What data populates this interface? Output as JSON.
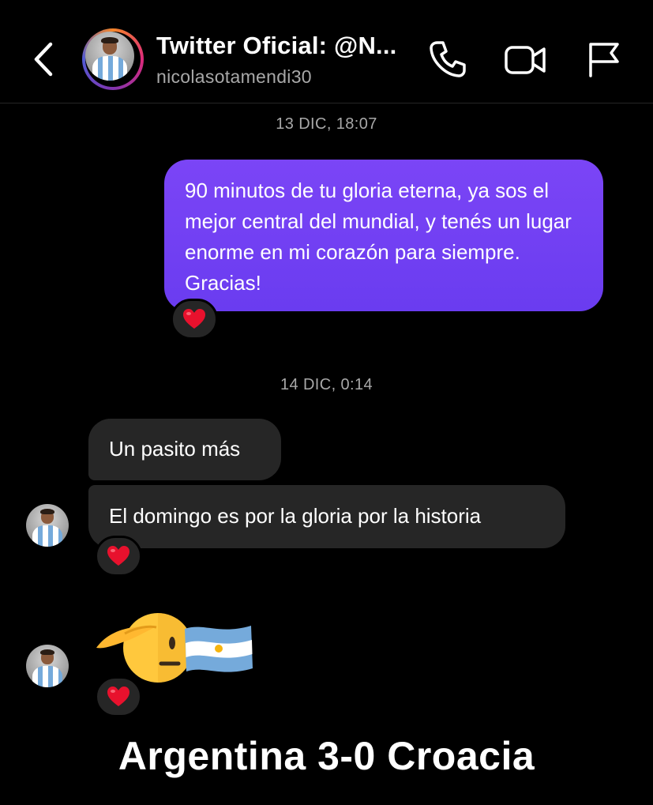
{
  "header": {
    "contact_name": "Twitter Oficial: @N...",
    "username": "nicolasotamendi30",
    "icons": [
      "back-chevron-icon",
      "phone-icon",
      "video-icon",
      "flag-icon"
    ]
  },
  "conversation": {
    "timestamp_1": "13 DIC, 18:07",
    "outgoing_message": "90 minutos de tu gloria eterna, ya sos el mejor central del mundial, y tenés un lugar enorme en mi corazón para siempre. Gracias!",
    "outgoing_reaction": "heart",
    "timestamp_2": "14 DIC, 0:14",
    "incoming_messages": [
      {
        "text": "Un pasito más"
      },
      {
        "text": "El domingo es por la gloria por la historia",
        "reaction": "heart"
      }
    ],
    "emoji_message": {
      "emojis": [
        "saluting-face",
        "argentina-flag"
      ],
      "reaction": "heart"
    }
  },
  "caption": "Argentina 3-0 Croacia",
  "colors": {
    "background": "#000000",
    "outgoing_bubble": "#7442f2",
    "incoming_bubble": "#262626",
    "heart": "#e8112d",
    "secondary_text": "#a8a8a8"
  }
}
